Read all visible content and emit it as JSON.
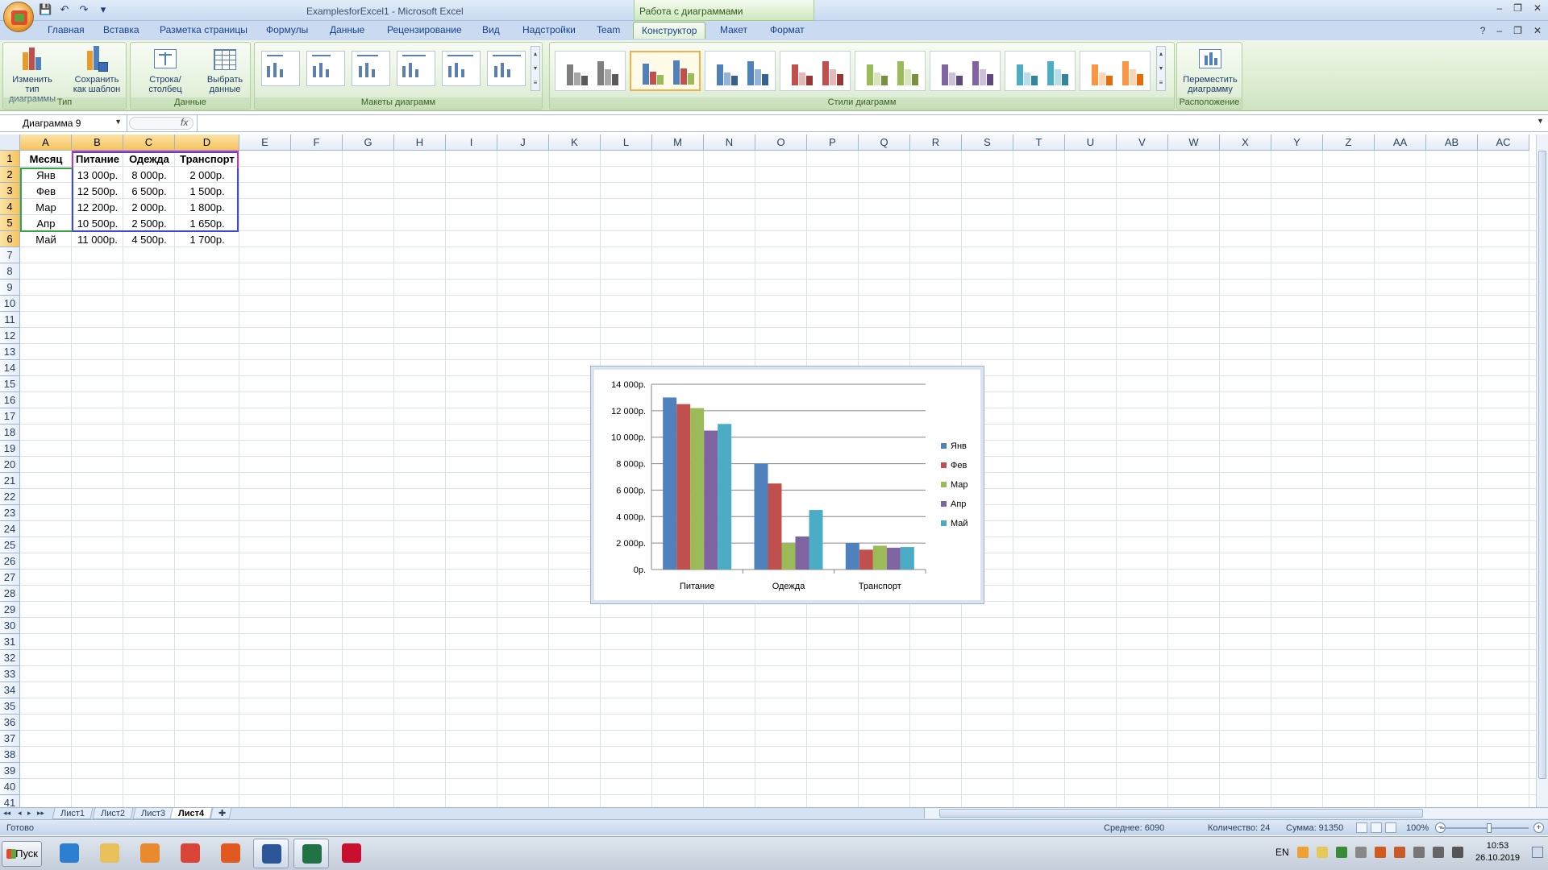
{
  "window": {
    "doc_title": "ExamplesforExcel1  -  Microsoft Excel",
    "context_group": "Работа с диаграммами",
    "controls": {
      "minimize": "–",
      "restore": "❐",
      "close": "✕"
    },
    "workbook_controls": {
      "help": "?",
      "minimize": "–",
      "restore": "❐",
      "close": "✕"
    }
  },
  "qat": {
    "save": "💾",
    "undo": "↶",
    "redo": "↷",
    "customize": "▾"
  },
  "tabs": [
    {
      "label": "Главная"
    },
    {
      "label": "Вставка"
    },
    {
      "label": "Разметка страницы"
    },
    {
      "label": "Формулы"
    },
    {
      "label": "Данные"
    },
    {
      "label": "Рецензирование"
    },
    {
      "label": "Вид"
    },
    {
      "label": "Надстройки"
    },
    {
      "label": "Team"
    },
    {
      "label": "Конструктор"
    },
    {
      "label": "Макет"
    },
    {
      "label": "Формат"
    }
  ],
  "active_tab": "Конструктор",
  "ribbon": {
    "type_group": {
      "label": "Тип",
      "change_type": "Изменить тип диаграммы",
      "save_template": "Сохранить как шаблон"
    },
    "data_group": {
      "label": "Данные",
      "switch_row_col": "Строка/столбец",
      "select_data": "Выбрать данные"
    },
    "layouts_group": {
      "label": "Макеты диаграмм"
    },
    "styles_group": {
      "label": "Стили диаграмм",
      "styles": [
        {
          "colors": [
            "#7f7f7f",
            "#a6a6a6",
            "#595959"
          ]
        },
        {
          "colors": [
            "#4f81bd",
            "#c0504d",
            "#9bbb59"
          ]
        },
        {
          "colors": [
            "#4f81bd",
            "#95b3d7",
            "#366092"
          ]
        },
        {
          "colors": [
            "#c0504d",
            "#e6b9b8",
            "#953735"
          ]
        },
        {
          "colors": [
            "#9bbb59",
            "#d7e4bd",
            "#76923c"
          ]
        },
        {
          "colors": [
            "#8064a2",
            "#ccc1da",
            "#5f497a"
          ]
        },
        {
          "colors": [
            "#4bacc6",
            "#b7dee8",
            "#31859c"
          ]
        },
        {
          "colors": [
            "#f79646",
            "#fcd5b5",
            "#e46c0a"
          ]
        }
      ],
      "selected_index": 1
    },
    "location_group": {
      "label": "Расположение",
      "move_chart": "Переместить диаграмму"
    }
  },
  "formula_bar": {
    "name_box": "Диаграмма 9",
    "fx": "fx",
    "value": ""
  },
  "sheet": {
    "columns": [
      "A",
      "B",
      "C",
      "D",
      "E",
      "F",
      "G",
      "H",
      "I",
      "J",
      "K",
      "L",
      "M",
      "N",
      "O",
      "P",
      "Q",
      "R",
      "S",
      "T",
      "U",
      "V",
      "W",
      "X",
      "Y",
      "Z",
      "AA",
      "AB",
      "AC"
    ],
    "selected_columns": [
      "A",
      "B",
      "C",
      "D"
    ],
    "row_count": 41,
    "selected_rows": [
      1,
      2,
      3,
      4,
      5,
      6
    ],
    "table": {
      "headers": [
        "Месяц",
        "Питание",
        "Одежда",
        "Транспорт"
      ],
      "rows": [
        [
          "Янв",
          "13 000р.",
          "8 000р.",
          "2 000р."
        ],
        [
          "Фев",
          "12 500р.",
          "6 500р.",
          "1 500р."
        ],
        [
          "Мар",
          "12 200р.",
          "2 000р.",
          "1 800р."
        ],
        [
          "Апр",
          "10 500р.",
          "2 500р.",
          "1 650р."
        ],
        [
          "Май",
          "11 000р.",
          "4 500р.",
          "1 700р."
        ]
      ]
    }
  },
  "chart_data": {
    "type": "bar",
    "categories": [
      "Питание",
      "Одежда",
      "Транспорт"
    ],
    "series": [
      {
        "name": "Янв",
        "values": [
          13000,
          8000,
          2000
        ],
        "color": "#4f81bd"
      },
      {
        "name": "Фев",
        "values": [
          12500,
          6500,
          1500
        ],
        "color": "#c0504d"
      },
      {
        "name": "Мар",
        "values": [
          12200,
          2000,
          1800
        ],
        "color": "#9bbb59"
      },
      {
        "name": "Апр",
        "values": [
          10500,
          2500,
          1650
        ],
        "color": "#8064a2"
      },
      {
        "name": "Май",
        "values": [
          11000,
          4500,
          1700
        ],
        "color": "#4bacc6"
      }
    ],
    "ylim": [
      0,
      14000
    ],
    "yticks": [
      0,
      2000,
      4000,
      6000,
      8000,
      10000,
      12000,
      14000
    ],
    "ytick_labels": [
      "0р.",
      "2 000р.",
      "4 000р.",
      "6 000р.",
      "8 000р.",
      "10 000р.",
      "12 000р.",
      "14 000р."
    ],
    "grid": true,
    "legend": "right",
    "title": "",
    "xlabel": "",
    "ylabel": ""
  },
  "sheet_tabs": [
    {
      "label": "Лист1"
    },
    {
      "label": "Лист2"
    },
    {
      "label": "Лист3"
    },
    {
      "label": "Лист4"
    }
  ],
  "active_sheet": "Лист4",
  "status": {
    "ready": "Готово",
    "average": "Среднее: 6090",
    "count": "Количество: 24",
    "sum": "Сумма: 91350",
    "zoom": "100%",
    "zoom_level_percent": 100
  },
  "taskbar": {
    "start": "Пуск",
    "apps": [
      {
        "name": "internet-explorer",
        "color": "#2c7fd0",
        "open": false
      },
      {
        "name": "file-explorer",
        "color": "#e8c15a",
        "open": false
      },
      {
        "name": "media-player",
        "color": "#e88a2d",
        "open": false
      },
      {
        "name": "chrome",
        "color": "#d94437",
        "open": false
      },
      {
        "name": "firefox",
        "color": "#e2591f",
        "open": false
      },
      {
        "name": "word",
        "color": "#2b579a",
        "open": true
      },
      {
        "name": "excel",
        "color": "#217346",
        "open": true
      },
      {
        "name": "acrobat",
        "color": "#c8102e",
        "open": false
      }
    ],
    "lang": "EN",
    "time": "10:53",
    "date": "26.10.2019"
  }
}
